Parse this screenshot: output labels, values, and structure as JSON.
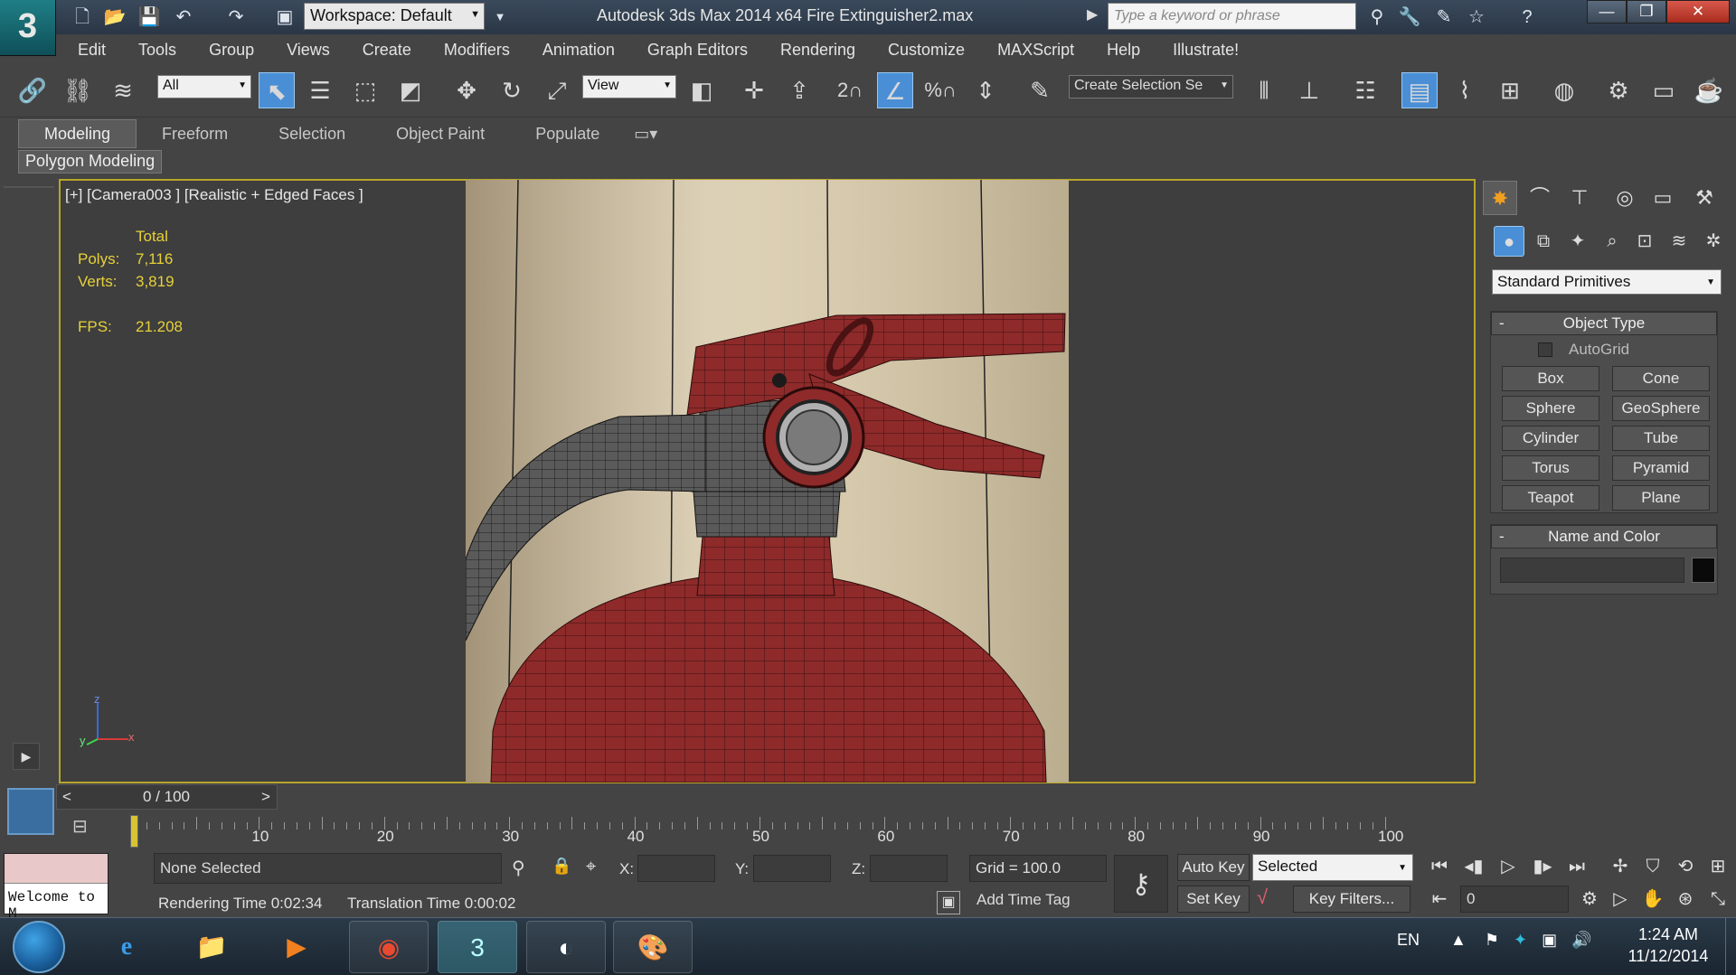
{
  "titlebar": {
    "workspace": "Workspace: Default",
    "title": "Autodesk 3ds Max  2014 x64      Fire Extinguisher2.max",
    "search_placeholder": "Type a keyword or phrase"
  },
  "menu": [
    "Edit",
    "Tools",
    "Group",
    "Views",
    "Create",
    "Modifiers",
    "Animation",
    "Graph Editors",
    "Rendering",
    "Customize",
    "MAXScript",
    "Help",
    "Illustrate!"
  ],
  "toolbar": {
    "filter": "All",
    "refcoord": "View",
    "snap_label": "2",
    "percent_label": "%",
    "named_selection": "Create Selection Se"
  },
  "ribbon": {
    "tabs": [
      "Modeling",
      "Freeform",
      "Selection",
      "Object Paint",
      "Populate"
    ],
    "panel": "Polygon Modeling"
  },
  "viewport": {
    "label": "[+] [Camera003 ] [Realistic + Edged Faces ]",
    "stats_header": "Total",
    "polys_label": "Polys:",
    "polys": "7,116",
    "verts_label": "Verts:",
    "verts": "3,819",
    "fps_label": "FPS:",
    "fps": "21.208",
    "axis_z": "z",
    "axis_x": "x",
    "axis_y": "y"
  },
  "command_panel": {
    "category": "Standard Primitives",
    "object_type_title": "Object Type",
    "autogrid": "AutoGrid",
    "buttons": [
      "Box",
      "Cone",
      "Sphere",
      "GeoSphere",
      "Cylinder",
      "Tube",
      "Torus",
      "Pyramid",
      "Teapot",
      "Plane"
    ],
    "name_color_title": "Name and Color"
  },
  "timeline": {
    "frame_display": "0 / 100",
    "prev": "<",
    "next": ">",
    "ticks": [
      "10",
      "20",
      "30",
      "40",
      "50",
      "60",
      "70",
      "80",
      "90",
      "100"
    ]
  },
  "status": {
    "selection": "None Selected",
    "x_label": "X:",
    "y_label": "Y:",
    "z_label": "Z:",
    "grid": "Grid = 100.0",
    "render_time": "Rendering Time  0:02:34",
    "translation_time": "Translation Time  0:00:02",
    "add_time_tag": "Add Time Tag",
    "auto_key": "Auto Key",
    "set_key": "Set Key",
    "selected": "Selected",
    "key_filters": "Key Filters...",
    "frame": "0",
    "welcome": "Welcome to M"
  },
  "taskbar": {
    "language": "EN",
    "time": "1:24 AM",
    "date": "11/12/2014"
  }
}
